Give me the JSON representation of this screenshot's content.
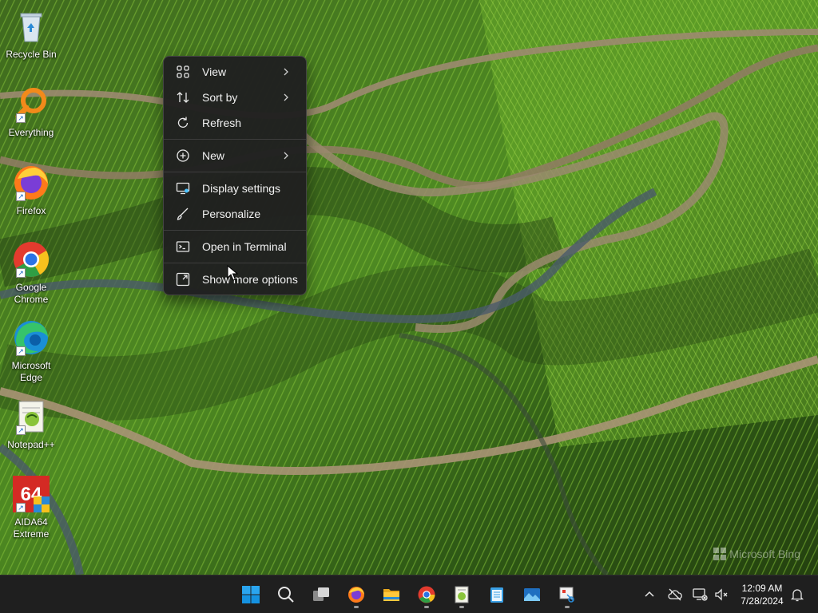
{
  "desktop": {
    "icons": [
      {
        "label": "Recycle Bin",
        "icon": "recycle-bin-icon"
      },
      {
        "label": "Everything",
        "icon": "everything-search-icon"
      },
      {
        "label": "Firefox",
        "icon": "firefox-icon"
      },
      {
        "label": "Google\nChrome",
        "icon": "chrome-icon"
      },
      {
        "label": "Microsoft\nEdge",
        "icon": "edge-icon"
      },
      {
        "label": "Notepad++",
        "icon": "notepad-plus-plus-icon"
      },
      {
        "label": "AIDA64\nExtreme",
        "icon": "aida64-icon"
      }
    ],
    "watermark": "Microsoft Bing"
  },
  "context_menu": {
    "items": [
      {
        "label": "View",
        "icon": "grid-icon",
        "submenu": true
      },
      {
        "label": "Sort by",
        "icon": "sort-icon",
        "submenu": true
      },
      {
        "label": "Refresh",
        "icon": "refresh-icon",
        "submenu": false
      },
      {
        "label": "New",
        "icon": "plus-circle-icon",
        "submenu": true
      },
      {
        "label": "Display settings",
        "icon": "display-settings-icon",
        "submenu": false
      },
      {
        "label": "Personalize",
        "icon": "brush-icon",
        "submenu": false
      },
      {
        "label": "Open in Terminal",
        "icon": "terminal-icon",
        "submenu": false
      },
      {
        "label": "Show more options",
        "icon": "expand-icon",
        "submenu": false
      }
    ]
  },
  "taskbar": {
    "apps": [
      "start-icon",
      "search-icon",
      "task-view-icon",
      "firefox-icon",
      "file-explorer-icon",
      "chrome-icon",
      "notepad-plus-plus-icon",
      "notepad-icon",
      "image-viewer-icon",
      "snipping-tool-icon"
    ],
    "tray": [
      "chevron-up-icon",
      "cloud-offline-icon",
      "network-icon",
      "volume-muted-icon",
      "notification-icon"
    ],
    "time": "12:09 AM",
    "date": "7/28/2024"
  },
  "colors": {
    "menu_bg": "#202020",
    "taskbar_bg": "#1f1f1f",
    "accent": "#4cc2ff"
  }
}
